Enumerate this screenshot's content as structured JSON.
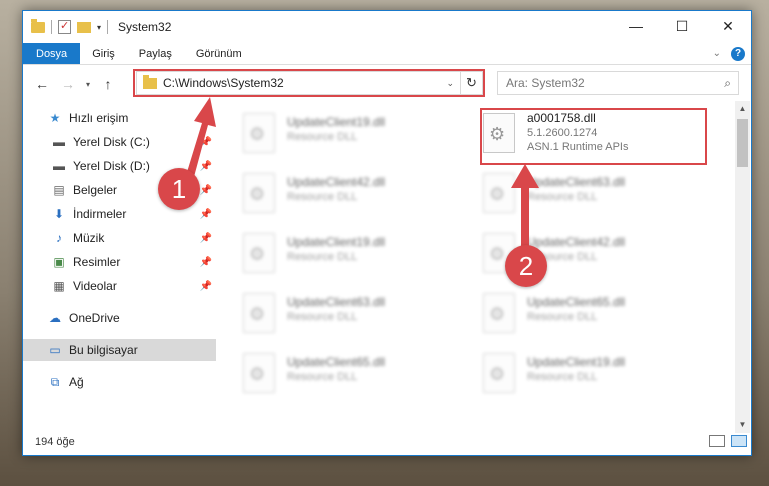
{
  "window": {
    "title": "System32"
  },
  "ribbon": {
    "tabs": [
      "Dosya",
      "Giriş",
      "Paylaş",
      "Görünüm"
    ]
  },
  "address": {
    "path": "C:\\Windows\\System32"
  },
  "search": {
    "placeholder": "Ara: System32"
  },
  "sidebar": {
    "items": [
      {
        "label": "Hızlı erişim",
        "icon": "star-icon"
      },
      {
        "label": "Yerel Disk (C:)",
        "icon": "drive-icon"
      },
      {
        "label": "Yerel Disk (D:)",
        "icon": "drive-icon"
      },
      {
        "label": "Belgeler",
        "icon": "documents-icon"
      },
      {
        "label": "İndirmeler",
        "icon": "download-icon"
      },
      {
        "label": "Müzik",
        "icon": "music-icon"
      },
      {
        "label": "Resimler",
        "icon": "pictures-icon"
      },
      {
        "label": "Videolar",
        "icon": "video-icon"
      },
      {
        "label": "OneDrive",
        "icon": "cloud-icon"
      },
      {
        "label": "Bu bilgisayar",
        "icon": "computer-icon"
      },
      {
        "label": "Ağ",
        "icon": "network-icon"
      }
    ]
  },
  "files": {
    "left": [
      {
        "name": "UpdateClient19.dll",
        "desc": "Resource DLL"
      },
      {
        "name": "UpdateClient42.dll",
        "desc": "Resource DLL"
      },
      {
        "name": "UpdateClient19.dll",
        "desc": "Resource DLL"
      },
      {
        "name": "UpdateClient63.dll",
        "desc": "Resource DLL"
      },
      {
        "name": "UpdateClient65.dll",
        "desc": "Resource DLL"
      }
    ],
    "right": [
      {
        "name": "UpdateClient63.dll",
        "desc": "Resource DLL"
      },
      {
        "name": "UpdateClient42.dll",
        "desc": "Resource DLL"
      },
      {
        "name": "UpdateClient65.dll",
        "desc": "Resource DLL"
      },
      {
        "name": "UpdateClient19.dll",
        "desc": "Resource DLL"
      }
    ],
    "target": {
      "name": "a0001758.dll",
      "version": "5.1.2600.1274",
      "desc": "ASN.1 Runtime APIs"
    }
  },
  "status": {
    "count": "194 öğe"
  },
  "annotations": {
    "step1": "1",
    "step2": "2",
    "color": "#d9474a"
  },
  "colors": {
    "accent": "#1979ca"
  }
}
